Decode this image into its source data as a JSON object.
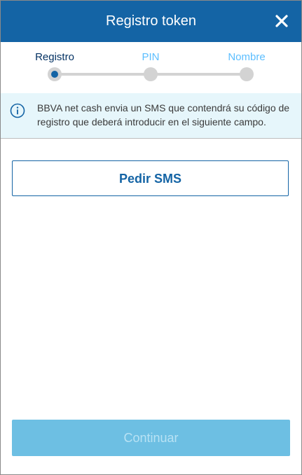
{
  "header": {
    "title": "Registro token",
    "close_icon": "close-icon"
  },
  "steps": [
    {
      "label": "Registro",
      "active": true
    },
    {
      "label": "PIN",
      "active": false
    },
    {
      "label": "Nombre",
      "active": false
    }
  ],
  "info": {
    "icon": "info-icon",
    "text": "BBVA net cash envia un SMS que contendrá su código de registro que deberá introducir en el siguiente campo."
  },
  "actions": {
    "request_sms_label": "Pedir SMS",
    "continue_label": "Continuar",
    "continue_enabled": false
  },
  "colors": {
    "brand_blue": "#1464a5",
    "active_label": "#043263",
    "inactive_label": "#5bbeff",
    "info_background": "#e6f6fb",
    "disabled_button": "#6dbfe3"
  }
}
